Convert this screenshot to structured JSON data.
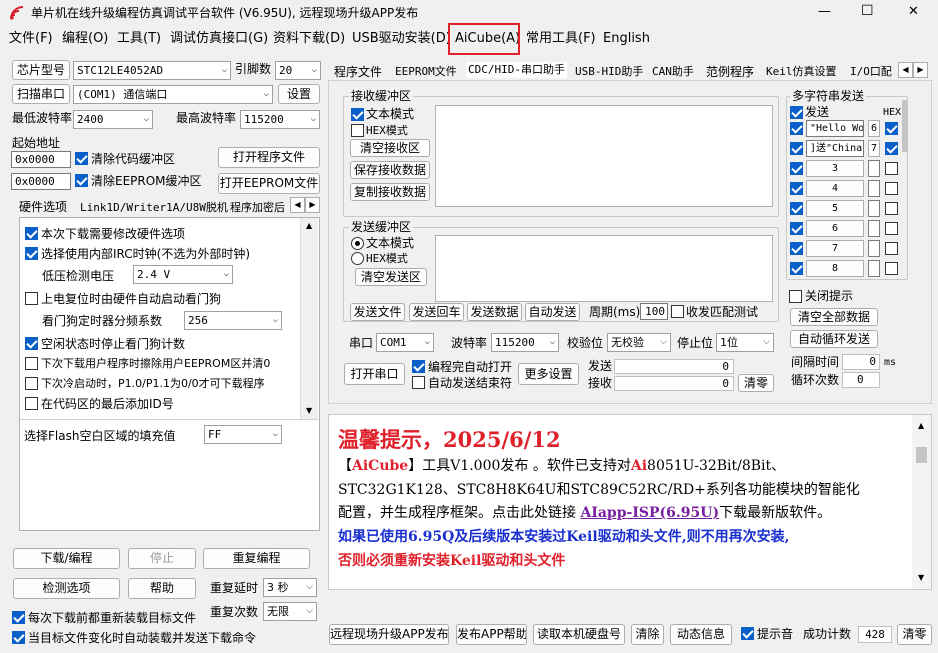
{
  "title": "单片机在线升级编程仿真调试平台软件 (V6.95U), 远程现场升级APP发布",
  "window_controls": {
    "minimize": "—",
    "maximize": "☐",
    "close": "✕"
  },
  "menu": [
    "文件(F)",
    "编程(O)",
    "工具(T)",
    "调试仿真接口(G)",
    "资料下载(D)",
    "USB驱动安装(D)",
    "AiCube(A)",
    "常用工具(F)",
    "English"
  ],
  "highlight_color": "#e0202a",
  "left": {
    "chip_btn": "芯片型号",
    "chip": "STC12LE4052AD",
    "pins_label": "引脚数",
    "pins": "20",
    "scan_btn": "扫描串口",
    "port": "(COM1) 通信端口",
    "settings_btn": "设置",
    "min_baud_label": "最低波特率",
    "min_baud": "2400",
    "max_baud_label": "最高波特率",
    "max_baud": "115200",
    "start_addr_label": "起始地址",
    "addr1": "0x0000",
    "clear_code": "清除代码缓冲区",
    "open_prog": "打开程序文件",
    "addr2": "0x0000",
    "clear_eeprom": "清除EEPROM缓冲区",
    "open_eeprom": "打开EEPROM文件",
    "tabs": [
      "硬件选项",
      "Link1D/Writer1A/U8W脱机",
      "程序加密后"
    ],
    "options": [
      {
        "text": "本次下载需要修改硬件选项",
        "checked": true
      },
      {
        "text": "选择使用内部IRC时钟(不选为外部时钟)",
        "checked": true
      },
      {
        "text": "低压检测电压",
        "value": "2.4 V"
      },
      {
        "text": "上电复位时由硬件自动启动看门狗",
        "checked": false
      },
      {
        "text": "看门狗定时器分频系数",
        "value": "256"
      },
      {
        "text": "空闲状态时停止看门狗计数",
        "checked": true
      },
      {
        "text": "下次下载用户程序时擦除用户EEPROM区并清0",
        "checked": false
      },
      {
        "text": "下次冷启动时，P1.0/P1.1为0/0才可下载程序",
        "checked": false
      },
      {
        "text": "在代码区的最后添加ID号",
        "checked": false
      }
    ],
    "fill_label": "选择Flash空白区域的填充值",
    "fill_value": "FF",
    "download_btn": "下载/编程",
    "stop_btn": "停止",
    "reprogram_btn": "重复编程",
    "detect_btn": "检测选项",
    "help_btn": "帮助",
    "repeat_delay_label": "重复延时",
    "repeat_delay": "3 秒",
    "repeat_count_label": "重复次数",
    "repeat_count": "无限",
    "reload_each": "每次下载前都重新装载目标文件",
    "auto_load": "当目标文件变化时自动装载并发送下载命令"
  },
  "right": {
    "tabs": [
      "程序文件",
      "EEPROM文件",
      "CDC/HID-串口助手",
      "USB-HID助手",
      "CAN助手",
      "范例程序",
      "Keil仿真设置",
      "I/O口配"
    ],
    "recv_group": "接收缓冲区",
    "text_mode": "文本模式",
    "hex_mode": "HEX模式",
    "clear_recv": "清空接收区",
    "save_recv": "保存接收数据",
    "copy_recv": "复制接收数据",
    "send_group": "发送缓冲区",
    "clear_send": "清空发送区",
    "send_file": "发送文件",
    "send_return": "发送回车",
    "send_data": "发送数据",
    "auto_send": "自动发送",
    "period_label": "周期(ms)",
    "period": "100",
    "match_test": "收发匹配测试",
    "port_label": "串口",
    "port": "COM1",
    "baud_label": "波特率",
    "baud": "115200",
    "parity_label": "校验位",
    "parity": "无校验",
    "stop_label": "停止位",
    "stop": "1位",
    "open_port": "打开串口",
    "auto_open": "编程完自动打开",
    "auto_end": "自动发送结束符",
    "more": "更多设置",
    "send_label": "发送",
    "send_count": "0",
    "recv_label": "接收",
    "recv_count": "0",
    "clear_count": "清零",
    "multi_group": "多字符串发送",
    "send_col": "发送",
    "hex_col": "HEX",
    "multi": [
      {
        "value": "\"Hello Wor",
        "btn": "6",
        "hex": true
      },
      {
        "value": "]送\"China!",
        "btn": "7",
        "hex": true
      },
      {
        "value": "",
        "btn": "3",
        "hex": false
      },
      {
        "value": "",
        "btn": "4",
        "hex": false
      },
      {
        "value": "",
        "btn": "5",
        "hex": false
      },
      {
        "value": "",
        "btn": "6",
        "hex": false
      },
      {
        "value": "",
        "btn": "7",
        "hex": false
      },
      {
        "value": "",
        "btn": "8",
        "hex": false
      }
    ],
    "close_tip": "关闭提示",
    "clear_all": "清空全部数据",
    "auto_loop": "自动循环发送",
    "interval_label": "间隔时间",
    "interval": "0",
    "ms": "ms",
    "loops_label": "循环次数",
    "loops": "0"
  },
  "notice": {
    "title": "温馨提示，2025/6/12",
    "l1a": "【",
    "l1b": "AiCube",
    "l1c": "】工具V1.000发布 。软件已支持对",
    "l1d": "Ai",
    "l1e": "8051U-32Bit/8Bit、",
    "l2": "STC32G1K128、STC8H8K64U和STC89C52RC/RD+系列各功能模块的智能化",
    "l3a": "配置，并生成程序框架。点击此处链接 ",
    "l3b": "AIapp-ISP(6.95U)",
    "l3c": "下载最新版软件。",
    "l4": "如果已使用6.95Q及后续版本安装过Keil驱动和头文件,则不用再次安装,",
    "l5": "否则必须重新安装Keil驱动和头文件"
  },
  "bottom": {
    "remote_btn": "远程现场升级APP发布",
    "publish_help": "发布APP帮助",
    "read_disk": "读取本机硬盘号",
    "clear": "清除",
    "anim": "动态信息",
    "tone": "提示音",
    "success_label": "成功计数",
    "success": "428",
    "clear_btn": "清零"
  }
}
